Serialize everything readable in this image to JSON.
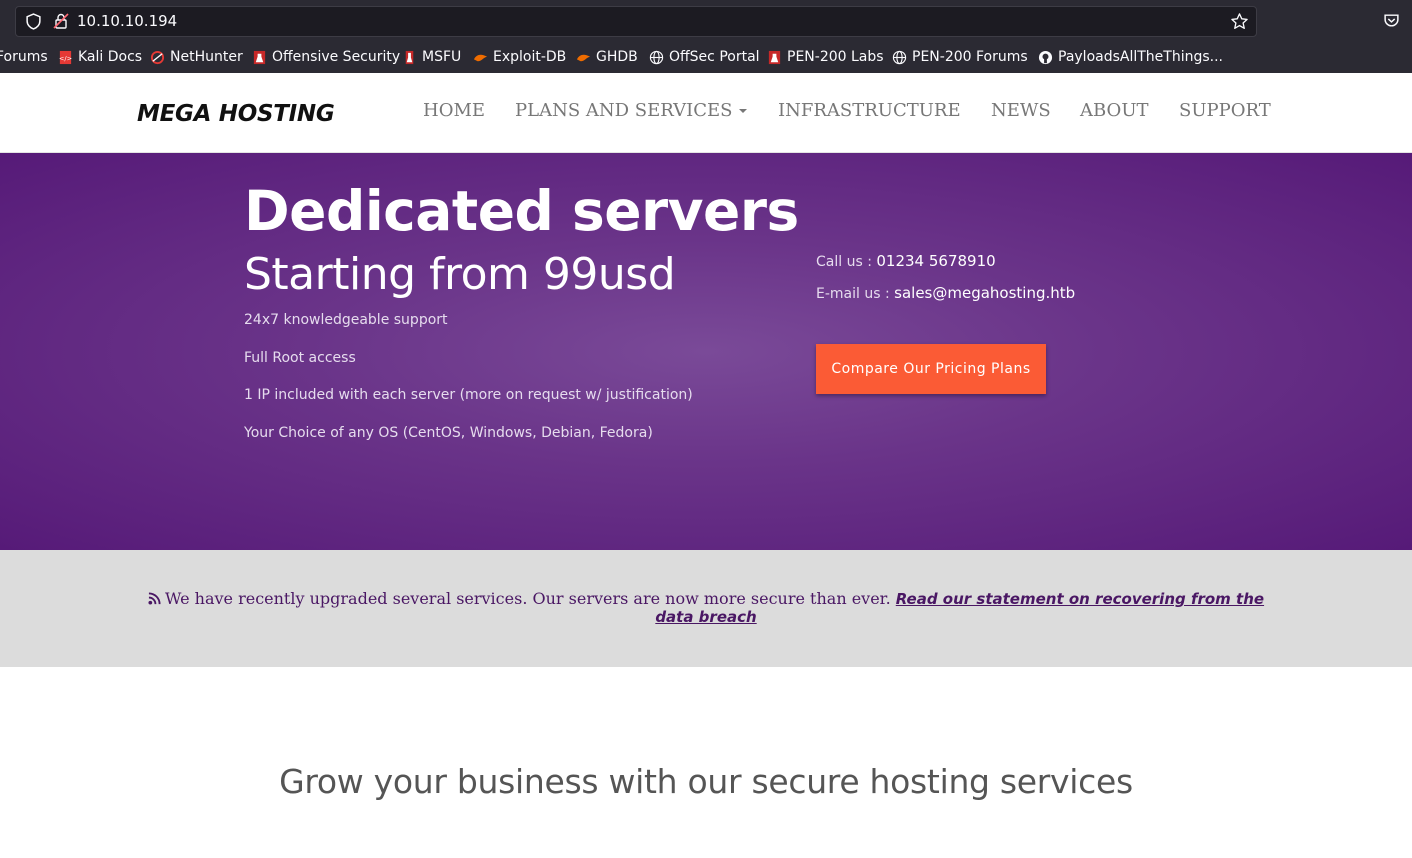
{
  "browser": {
    "url": "10.10.10.194",
    "bookmarks": [
      {
        "label": "Forums",
        "icon": "none"
      },
      {
        "label": "Kali Docs",
        "icon": "kali-docs-icon"
      },
      {
        "label": "NetHunter",
        "icon": "nethunter-icon"
      },
      {
        "label": "Offensive Security",
        "icon": "offsec-icon"
      },
      {
        "label": "MSFU",
        "icon": "offsec-icon"
      },
      {
        "label": "Exploit-DB",
        "icon": "exploitdb-icon"
      },
      {
        "label": "GHDB",
        "icon": "exploitdb-icon"
      },
      {
        "label": "OffSec Portal",
        "icon": "globe-icon"
      },
      {
        "label": "PEN-200 Labs",
        "icon": "offsec-icon"
      },
      {
        "label": "PEN-200 Forums",
        "icon": "globe-icon"
      },
      {
        "label": "PayloadsAllTheThings...",
        "icon": "github-icon"
      }
    ]
  },
  "header": {
    "logo": "MEGA HOSTING",
    "nav": [
      "HOME",
      "PLANS AND SERVICES",
      "INFRASTRUCTURE",
      "NEWS",
      "ABOUT",
      "SUPPORT"
    ]
  },
  "hero": {
    "title": "Dedicated servers",
    "subtitle": "Starting from 99usd",
    "features": [
      "24x7 knowledgeable support",
      "Full Root access",
      "1 IP included with each server (more on request w/ justification)",
      "Your Choice of any OS (CentOS, Windows, Debian, Fedora)"
    ],
    "call_label": "Call us : ",
    "call_value": "01234 5678910",
    "email_label": "E-mail us : ",
    "email_value": "sales@megahosting.htb",
    "cta": "Compare Our Pricing Plans"
  },
  "notice": {
    "text": "We have recently upgraded several services. Our servers are now more secure than ever. ",
    "link": "Read our statement on recovering from the data breach"
  },
  "section": {
    "heading": "Grow your business with our secure hosting services"
  },
  "colors": {
    "hero_purple": "#6a3489",
    "cta_orange": "#fb5b35",
    "notice_bg": "#dcdcdc",
    "notice_text": "#4a1764"
  }
}
